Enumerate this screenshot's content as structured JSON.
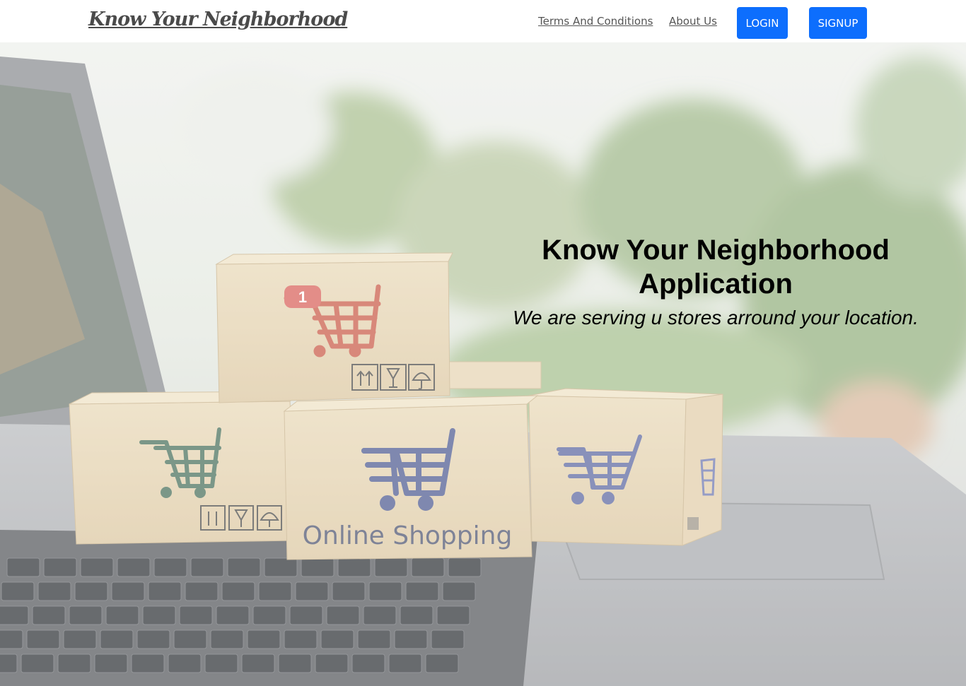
{
  "navbar": {
    "brand": "Know Your Neighborhood",
    "links": {
      "terms": "Terms And Conditions",
      "about": "About Us"
    },
    "buttons": {
      "login": "LOGIN",
      "signup": "SIGNUP"
    }
  },
  "hero": {
    "title": "Know Your Neighborhood Application",
    "subtitle": "We are serving u stores arround your location.",
    "image_text": "Online Shopping",
    "badge_count": "1"
  },
  "colors": {
    "primary": "#0d6efd",
    "brand_text": "#4a4a4a",
    "link_text": "#555555"
  },
  "icons": [
    "shopping-cart-icon",
    "fragile-glass-icon",
    "keep-dry-umbrella-icon",
    "this-side-up-icon"
  ]
}
